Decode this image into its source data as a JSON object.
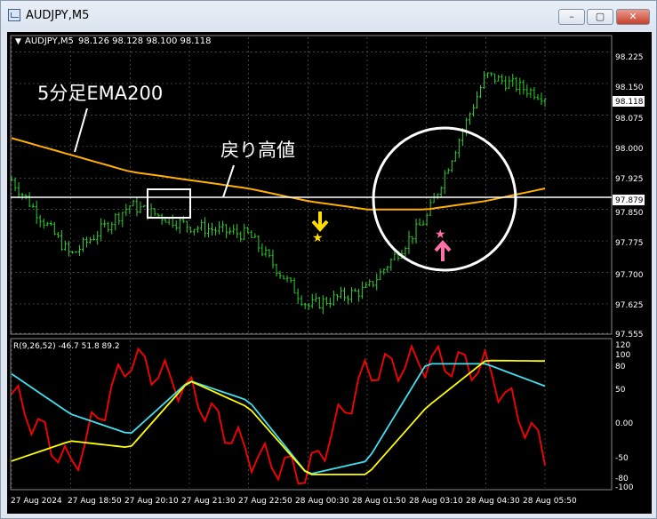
{
  "window": {
    "title": "AUDJPY,M5",
    "minimize_glyph": "–",
    "maximize_glyph": "▢",
    "close_glyph": "✕"
  },
  "chart": {
    "symbol_label": "AUDJPY,M5",
    "ohlc_text": "98.126 98.128 98.100 98.118",
    "colors": {
      "background": "#000000",
      "grid": "#5a5a5a",
      "candles": "#32cd32",
      "ema": "#ffb000",
      "resistance_line": "#ffffff",
      "annotation_circle": "#ffffff",
      "osc_red": "#ff0000",
      "osc_cyan": "#40e0f0",
      "osc_yellow": "#ffff00",
      "down_arrow": "#ffdd00",
      "up_arrow": "#ff6fa8"
    },
    "annotations": {
      "ema_label": "5分足EMA200",
      "pullback_label": "戻り高値"
    },
    "price_axis": {
      "ticks": [
        "98.225",
        "98.150",
        "98.075",
        "98.000",
        "97.925",
        "97.850",
        "97.775",
        "97.700",
        "97.625",
        "97.555"
      ],
      "current_price": "98.118",
      "line_price": "97.879"
    },
    "oscillator": {
      "label": "R(9,26,52) -46.7 51.8 89.2",
      "ticks": [
        "120",
        "100",
        "80",
        "50",
        "0.00",
        "-50",
        "-80",
        "-100"
      ]
    },
    "time_axis": [
      "27 Aug 2024",
      "27 Aug 18:50",
      "27 Aug 20:10",
      "27 Aug 21:30",
      "27 Aug 22:50",
      "28 Aug 00:30",
      "28 Aug 01:50",
      "28 Aug 03:10",
      "28 Aug 04:30",
      "28 Aug 05:50"
    ]
  },
  "chart_data": {
    "type": "line",
    "x": [
      "27 Aug 2024",
      "27 Aug 18:50",
      "27 Aug 20:10",
      "27 Aug 21:30",
      "27 Aug 22:50",
      "28 Aug 00:30",
      "28 Aug 01:50",
      "28 Aug 03:10",
      "28 Aug 04:30",
      "28 Aug 05:50"
    ],
    "price_ylim": [
      97.555,
      98.26
    ],
    "series": [
      {
        "name": "price",
        "values": [
          97.92,
          97.74,
          97.86,
          97.81,
          97.79,
          97.62,
          97.66,
          97.83,
          98.17,
          98.12
        ]
      },
      {
        "name": "EMA200",
        "values": [
          98.02,
          97.98,
          97.94,
          97.92,
          97.9,
          97.87,
          97.85,
          97.85,
          97.87,
          97.9
        ]
      }
    ],
    "oscillator_ylim": [
      -100,
      120
    ],
    "oscillator_series": [
      {
        "name": "9",
        "values": [
          40,
          -70,
          95,
          45,
          -50,
          -80,
          75,
          90,
          80,
          -46.7
        ]
      },
      {
        "name": "26",
        "values": [
          70,
          10,
          -20,
          60,
          30,
          -80,
          -60,
          85,
          85,
          51.8
        ]
      },
      {
        "name": "52",
        "values": [
          -60,
          -30,
          -40,
          60,
          20,
          -80,
          -80,
          20,
          90,
          89.2
        ]
      }
    ]
  }
}
